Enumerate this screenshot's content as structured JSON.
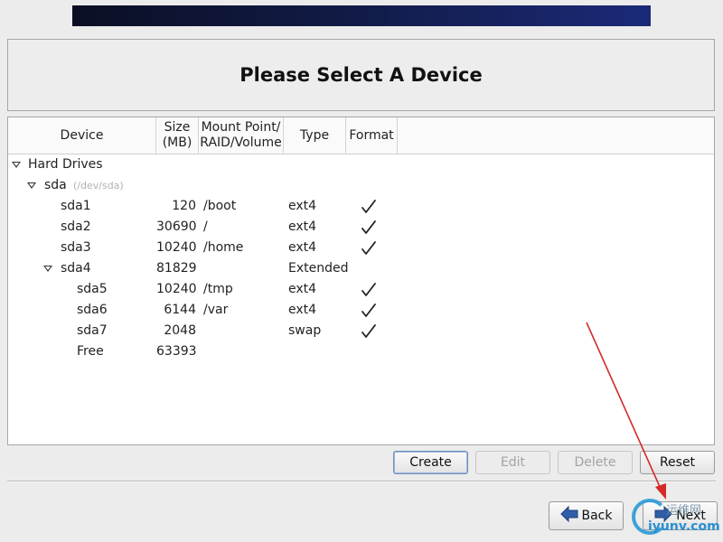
{
  "header": {
    "title": "Please Select A Device"
  },
  "columns": {
    "device": "Device",
    "size_line1": "Size",
    "size_line2": "(MB)",
    "mount_line1": "Mount Point/",
    "mount_line2": "RAID/Volume",
    "type": "Type",
    "format": "Format"
  },
  "rows": [
    {
      "name": "Hard Drives",
      "size": "",
      "mount": "",
      "type": "",
      "format": false,
      "expanded": true,
      "level": 0
    },
    {
      "name": "sda",
      "path": "(/dev/sda)",
      "size": "",
      "mount": "",
      "type": "",
      "format": false,
      "expanded": true,
      "level": 1
    },
    {
      "name": "sda1",
      "size": "120",
      "mount": "/boot",
      "type": "ext4",
      "format": true,
      "level": 2
    },
    {
      "name": "sda2",
      "size": "30690",
      "mount": "/",
      "type": "ext4",
      "format": true,
      "level": 2
    },
    {
      "name": "sda3",
      "size": "10240",
      "mount": "/home",
      "type": "ext4",
      "format": true,
      "level": 2
    },
    {
      "name": "sda4",
      "size": "81829",
      "mount": "",
      "type": "Extended",
      "format": false,
      "expanded": true,
      "level": 2
    },
    {
      "name": "sda5",
      "size": "10240",
      "mount": "/tmp",
      "type": "ext4",
      "format": true,
      "level": 3
    },
    {
      "name": "sda6",
      "size": "6144",
      "mount": "/var",
      "type": "ext4",
      "format": true,
      "level": 3
    },
    {
      "name": "sda7",
      "size": "2048",
      "mount": "",
      "type": "swap",
      "format": true,
      "level": 3
    },
    {
      "name": "Free",
      "size": "63393",
      "mount": "",
      "type": "",
      "format": false,
      "level": 3
    }
  ],
  "actions": {
    "create": "Create",
    "edit": "Edit",
    "delete": "Delete",
    "reset": "Reset"
  },
  "nav": {
    "back": "Back",
    "next": "Next"
  },
  "watermark": {
    "top": "运维网",
    "bottom": "iyunv.com"
  },
  "colors": {
    "annotation_arrow": "#d42a2a",
    "banner_dark": "#0b0f24",
    "banner_light": "#1b2a78",
    "back_arrow": "#2f5ea8"
  }
}
